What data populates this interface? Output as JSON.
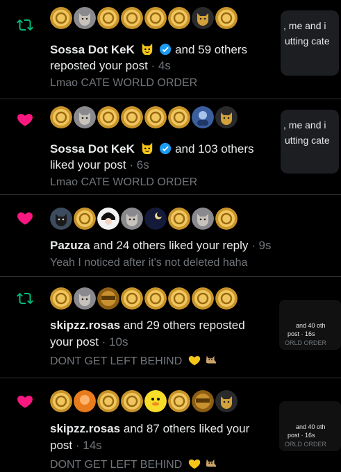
{
  "notifications": [
    {
      "type": "repost",
      "icon": "repost-icon",
      "user": "Sossa Dot KeK",
      "user_emoji": "cat-face-icon",
      "verified": true,
      "line1_rest": "and 59 others",
      "line2": "reposted your post",
      "time": "· 4s",
      "snippet": "Lmao CATE WORLD ORDER",
      "avatars": [
        "coin-avatar",
        "cat-avatar",
        "coin-avatar",
        "coin-avatar",
        "coin-avatar",
        "coin-avatar",
        "gold-cat-avatar",
        "coin-avatar"
      ]
    },
    {
      "type": "like",
      "icon": "heart-icon",
      "user": "Sossa Dot KeK",
      "user_emoji": "cat-face-icon",
      "verified": true,
      "line1_rest": "and 103 others",
      "line2": "liked your post",
      "time": "· 6s",
      "snippet": "Lmao CATE WORLD ORDER",
      "avatars": [
        "coin-avatar",
        "cat-avatar",
        "coin-avatar",
        "coin-avatar",
        "coin-avatar",
        "coin-avatar",
        "blue-avatar",
        "gold-cat-avatar"
      ]
    },
    {
      "type": "like",
      "icon": "heart-icon",
      "user": "Pazuza",
      "line1_rest": "and 24 others liked your reply",
      "time": "· 9s",
      "snippet": "Yeah I noticed after it's not deleted haha",
      "avatars": [
        "dark-cat-avatar",
        "coin-avatar",
        "anime-avatar",
        "cat-avatar",
        "night-avatar",
        "coin-avatar",
        "cat-avatar",
        "coin-avatar"
      ]
    },
    {
      "type": "repost",
      "icon": "repost-icon",
      "user": "skipzz.rosas",
      "line1_rest": "and 29 others reposted",
      "line2": "your post",
      "time": "· 10s",
      "snippet": "DONT GET LEFT BEHIND",
      "avatars": [
        "coin-avatar",
        "cat-avatar",
        "reward-avatar",
        "coin-avatar",
        "coin-avatar",
        "coin-avatar",
        "coin-avatar",
        "coin-avatar"
      ]
    },
    {
      "type": "like",
      "icon": "heart-icon",
      "user": "skipzz.rosas",
      "line1_rest": "and 87 others liked your",
      "line2": "post",
      "time": "· 14s",
      "snippet": "DONT GET LEFT BEHIND",
      "avatars": [
        "coin-avatar",
        "orange-avatar",
        "coin-avatar",
        "coin-avatar",
        "duck-avatar",
        "coin-avatar",
        "reward-avatar",
        "gold-cat-avatar"
      ]
    }
  ],
  "overlays": {
    "top_card": {
      "line1": ", me and i",
      "line2": "utting cate"
    },
    "second_card": {
      "line1": ", me and i",
      "line2": "utting cate"
    },
    "mini_cards": [
      {
        "line1": "and 40 oth",
        "line2": "post · 16s",
        "line3": "ORLD ORDER"
      },
      {
        "line1": "and 40 oth",
        "line2": "post · 16s",
        "line3": "ORLD ORDER"
      }
    ]
  },
  "colors": {
    "like": "#f91880",
    "repost": "#00ba7c",
    "verified": "#1d9bf0",
    "muted": "#71767b"
  }
}
